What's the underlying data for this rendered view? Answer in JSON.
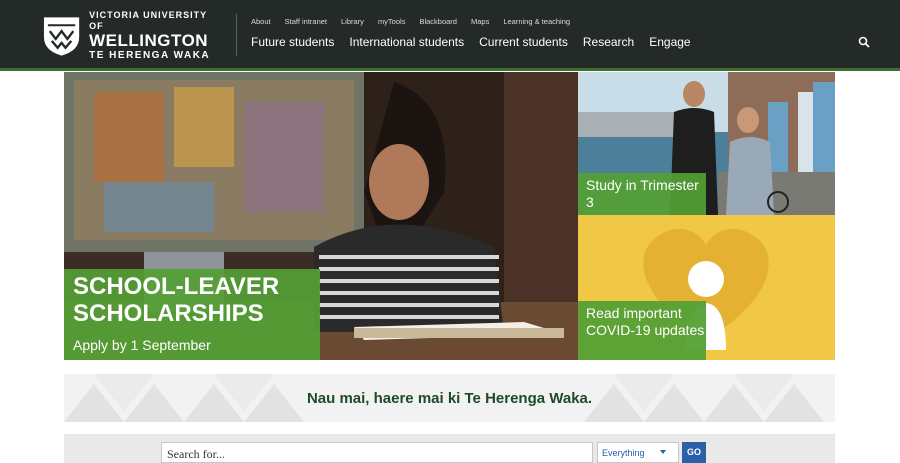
{
  "header": {
    "logo": {
      "line1": "VICTORIA UNIVERSITY OF",
      "line2": "WELLINGTON",
      "line3": "TE HERENGA WAKA"
    },
    "utility_links": [
      "About",
      "Staff intranet",
      "Library",
      "myTools",
      "Blackboard",
      "Maps",
      "Learning & teaching"
    ],
    "main_links": [
      "Future students",
      "International students",
      "Current students",
      "Research",
      "Engage"
    ],
    "search_icon": "search-icon"
  },
  "hero": {
    "title": "SCHOOL-LEAVER SCHOLARSHIPS",
    "subtitle": "Apply by 1 September"
  },
  "tiles": {
    "trimester": "Study in Trimester 3",
    "covid": "Read important COVID-19 updates"
  },
  "welcome": {
    "text": "Nau mai, haere mai ki Te Herenga Waka."
  },
  "search": {
    "placeholder": "Search for...",
    "scope": "Everything",
    "go_label": "GO"
  },
  "colors": {
    "header_bg": "#232a28",
    "accent_green": "#54a034",
    "covid_yellow": "#f1c845",
    "search_blue": "#2b5fa7",
    "welcome_text": "#1e4a2a"
  }
}
